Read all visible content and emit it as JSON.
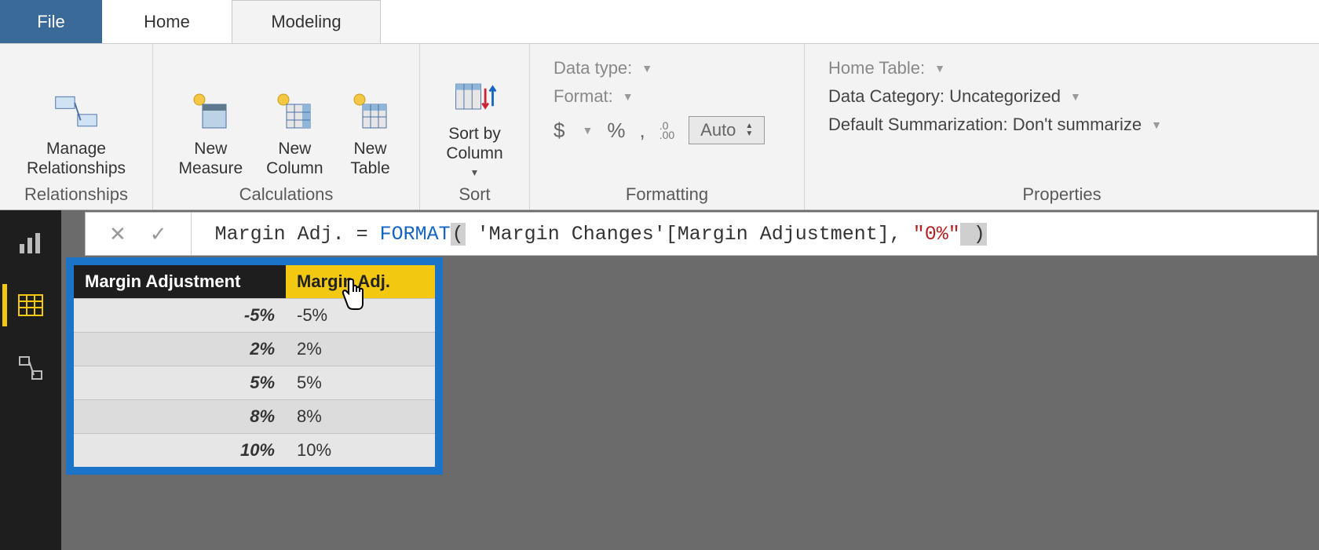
{
  "tabs": {
    "file": "File",
    "home": "Home",
    "modeling": "Modeling"
  },
  "ribbon": {
    "relationships": {
      "manage": "Manage\nRelationships",
      "title": "Relationships"
    },
    "calculations": {
      "newMeasure": "New\nMeasure",
      "newColumn": "New\nColumn",
      "newTable": "New\nTable",
      "title": "Calculations"
    },
    "sort": {
      "sortBy": "Sort by\nColumn",
      "title": "Sort"
    },
    "formatting": {
      "dataType": "Data type:",
      "format": "Format:",
      "dollar": "$",
      "percent": "%",
      "comma": ",",
      "decimals": ".0\n.00",
      "auto": "Auto",
      "title": "Formatting"
    },
    "properties": {
      "homeTable": "Home Table:",
      "dataCategory": "Data Category: Uncategorized",
      "defaultSummarization": "Default Summarization: Don't summarize",
      "title": "Properties"
    }
  },
  "formula": {
    "pre": "Margin Adj. = ",
    "kw": "FORMAT",
    "open": "(",
    "mid": " 'Margin Changes'[Margin Adjustment], ",
    "str": "\"0%\"",
    "close": " )"
  },
  "table": {
    "headers": {
      "col1": "Margin Adjustment",
      "col2": "Margin Adj."
    },
    "rows": [
      {
        "c1": "-5%",
        "c2": "-5%"
      },
      {
        "c1": "2%",
        "c2": "2%"
      },
      {
        "c1": "5%",
        "c2": "5%"
      },
      {
        "c1": "8%",
        "c2": "8%"
      },
      {
        "c1": "10%",
        "c2": "10%"
      }
    ]
  }
}
